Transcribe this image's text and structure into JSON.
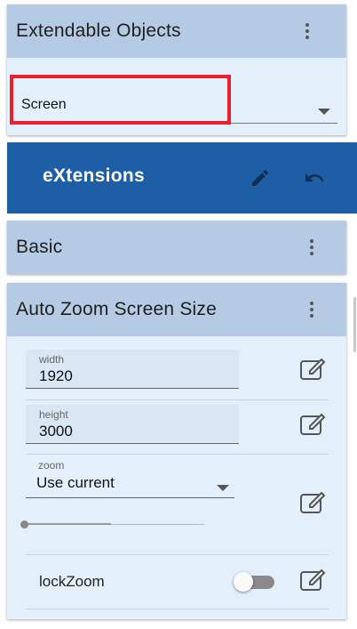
{
  "extendable": {
    "title": "Extendable Objects",
    "select_value": "Screen"
  },
  "extensions": {
    "title": "eXtensions"
  },
  "basic": {
    "title": "Basic"
  },
  "autozoom": {
    "title": "Auto Zoom Screen Size",
    "width_label": "width",
    "width_value": "1920",
    "height_label": "height",
    "height_value": "3000",
    "zoom_label": "zoom",
    "zoom_value": "Use current",
    "zoom_slider_fraction": 0.0,
    "lockzoom_label": "lockZoom",
    "lockzoom_on": false
  },
  "colors": {
    "panel_header": "#b5cbe3",
    "panel_body": "#e3f0fb",
    "extensions_bar": "#1d5ea4",
    "highlight_box": "#e8202a"
  },
  "icons": [
    "more-vert-icon",
    "pencil-icon",
    "undo-icon",
    "edit-note-icon",
    "dropdown-arrow-icon"
  ]
}
